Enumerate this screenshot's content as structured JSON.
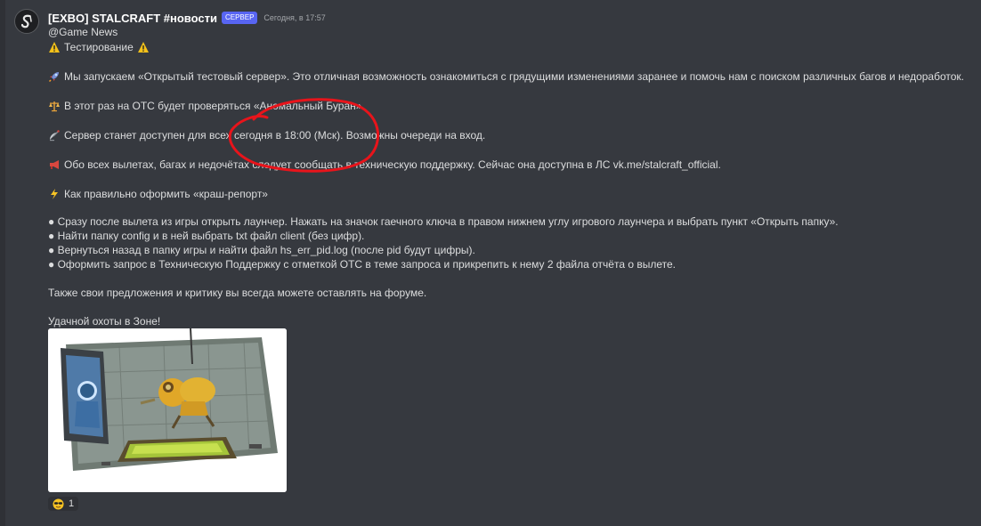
{
  "message": {
    "author": "[EXBO] STALCRAFT #новости",
    "badge": "СЕРВЕР",
    "timestamp": "Сегодня, в 17:57",
    "mention": "@Game News",
    "title": "Тестирование",
    "paragraph_launch": "Мы запускаем «Открытый тестовый сервер». Это отличная возможность ознакомиться с грядущими изменениями заранее и помочь нам с поиском различных багов и недоработок.",
    "paragraph_check": "В этот раз на ОТС будет проверяться «Аномальный Буран».",
    "paragraph_server": "Сервер станет доступен для всех сегодня в 18:00 (Мск). Возможны очереди на вход.",
    "paragraph_report": "Обо всех вылетах, багах и недочётах следует сообщать в техническую поддержку. Сейчас она доступна в ЛС vk.me/stalcraft_official.",
    "paragraph_crash_heading": "Как правильно оформить «краш-репорт»",
    "steps": [
      "● Сразу после вылета из игры открыть лаунчер. Нажать на значок гаечного ключа в правом нижнем углу игрового лаунчера и выбрать пункт «Открыть папку».",
      "● Найти папку config и в ней выбрать txt файл client (без цифр).",
      "● Вернуться назад в папку игры и найти файл hs_err_pid.log (после pid будут цифры).",
      "● Оформить запрос в Техническую Поддержку с отметкой ОТС в теме запроса и прикрепить к нему 2 файла отчёта о вылете."
    ],
    "paragraph_forum": "Также свои предложения и критику вы всегда можете оставлять на форуме.",
    "paragraph_goodluck": "Удачной охоты в Зоне!"
  },
  "reaction": {
    "emoji": "sunglasses-face",
    "count": "1"
  },
  "icons": {
    "warning": "warning-icon",
    "rocket": "rocket-icon",
    "scales": "scales-icon",
    "satellite": "satellite-icon",
    "megaphone": "megaphone-icon",
    "lightning": "lightning-icon"
  },
  "colors": {
    "background": "#36393f",
    "text": "#dcddde",
    "author": "#ffffff",
    "badge": "#5865f2",
    "annotation": "#e8141b"
  }
}
